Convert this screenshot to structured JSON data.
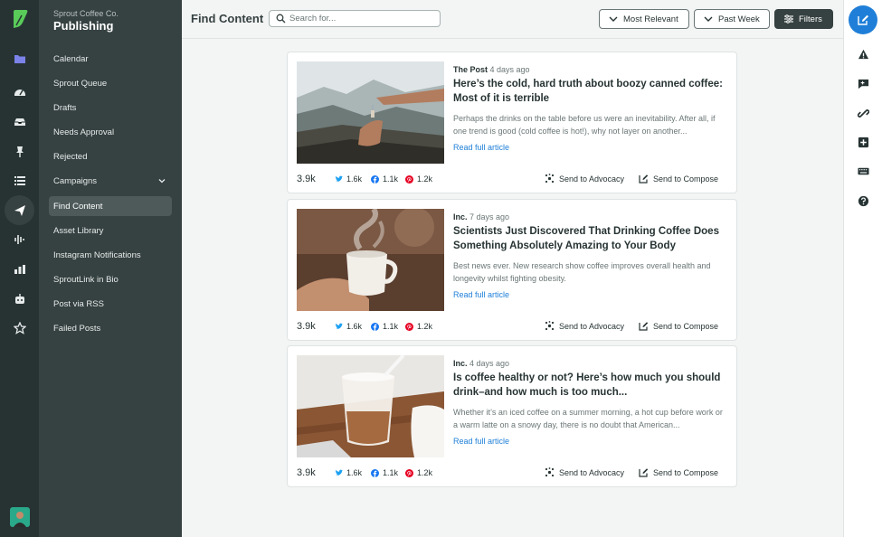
{
  "app": {
    "brand_sub": "Sprout Coffee Co.",
    "brand": "Publishing"
  },
  "nav": {
    "items": [
      {
        "label": "Calendar"
      },
      {
        "label": "Sprout Queue"
      },
      {
        "label": "Drafts"
      },
      {
        "label": "Needs Approval"
      },
      {
        "label": "Rejected"
      },
      {
        "label": "Campaigns"
      },
      {
        "label": "Find Content"
      },
      {
        "label": "Asset Library"
      },
      {
        "label": "Instagram Notifications"
      },
      {
        "label": "SproutLink in Bio"
      },
      {
        "label": "Post via RSS"
      },
      {
        "label": "Failed Posts"
      }
    ],
    "active": "Find Content"
  },
  "header": {
    "title": "Find Content",
    "search_placeholder": "Search for...",
    "sort_label": "Most Relevant",
    "range_label": "Past Week",
    "filters_label": "Filters"
  },
  "articles": [
    {
      "source": "The Post",
      "age": "4 days ago",
      "headline": "Here’s the cold, hard truth about boozy canned coffee: Most of it is terrible",
      "excerpt": "Perhaps the drinks on the table before us were an inevitability. After all, if one trend is good (cold coffee is hot!), why not layer on another...",
      "read_more": "Read full article",
      "total": "3.9k",
      "twitter": "1.6k",
      "facebook": "1.1k",
      "pinterest": "1.2k",
      "advocacy": "Send to Advocacy",
      "compose": "Send to Compose"
    },
    {
      "source": "Inc.",
      "age": "7 days ago",
      "headline": "Scientists Just Discovered That Drinking Coffee Does Something Absolutely Amazing to Your Body",
      "excerpt": "Best news ever. New research show coffee improves overall health and longevity whilst fighting obesity.",
      "read_more": "Read full article",
      "total": "3.9k",
      "twitter": "1.6k",
      "facebook": "1.1k",
      "pinterest": "1.2k",
      "advocacy": "Send to Advocacy",
      "compose": "Send to Compose"
    },
    {
      "source": "Inc.",
      "age": "4 days ago",
      "headline": "Is coffee healthy or not? Here’s how much you should drink–and how much is too much...",
      "excerpt": "Whether it’s an iced coffee on a summer morning, a hot cup before work or a warm latte on a snowy day, there is no doubt that American...",
      "read_more": "Read full article",
      "total": "3.9k",
      "twitter": "1.6k",
      "facebook": "1.1k",
      "pinterest": "1.2k",
      "advocacy": "Send to Advocacy",
      "compose": "Send to Compose"
    }
  ],
  "icons": {
    "rail": [
      "sprout-logo-icon",
      "folder-icon",
      "dashboard-icon",
      "inbox-icon",
      "pin-icon",
      "list-icon",
      "paper-plane-icon",
      "soundwave-icon",
      "bar-chart-icon",
      "bot-icon",
      "star-icon"
    ],
    "right_rail": [
      "compose-icon",
      "alert-icon",
      "message-icon",
      "link-icon",
      "plus-icon",
      "keyboard-icon",
      "help-icon"
    ]
  },
  "colors": {
    "brand_green": "#59cb59",
    "accent_blue": "#1f7fd8",
    "twitter": "#1da1f2",
    "facebook": "#1877f2",
    "pinterest": "#e60023",
    "sidebar": "#364141",
    "rail": "#273333"
  }
}
